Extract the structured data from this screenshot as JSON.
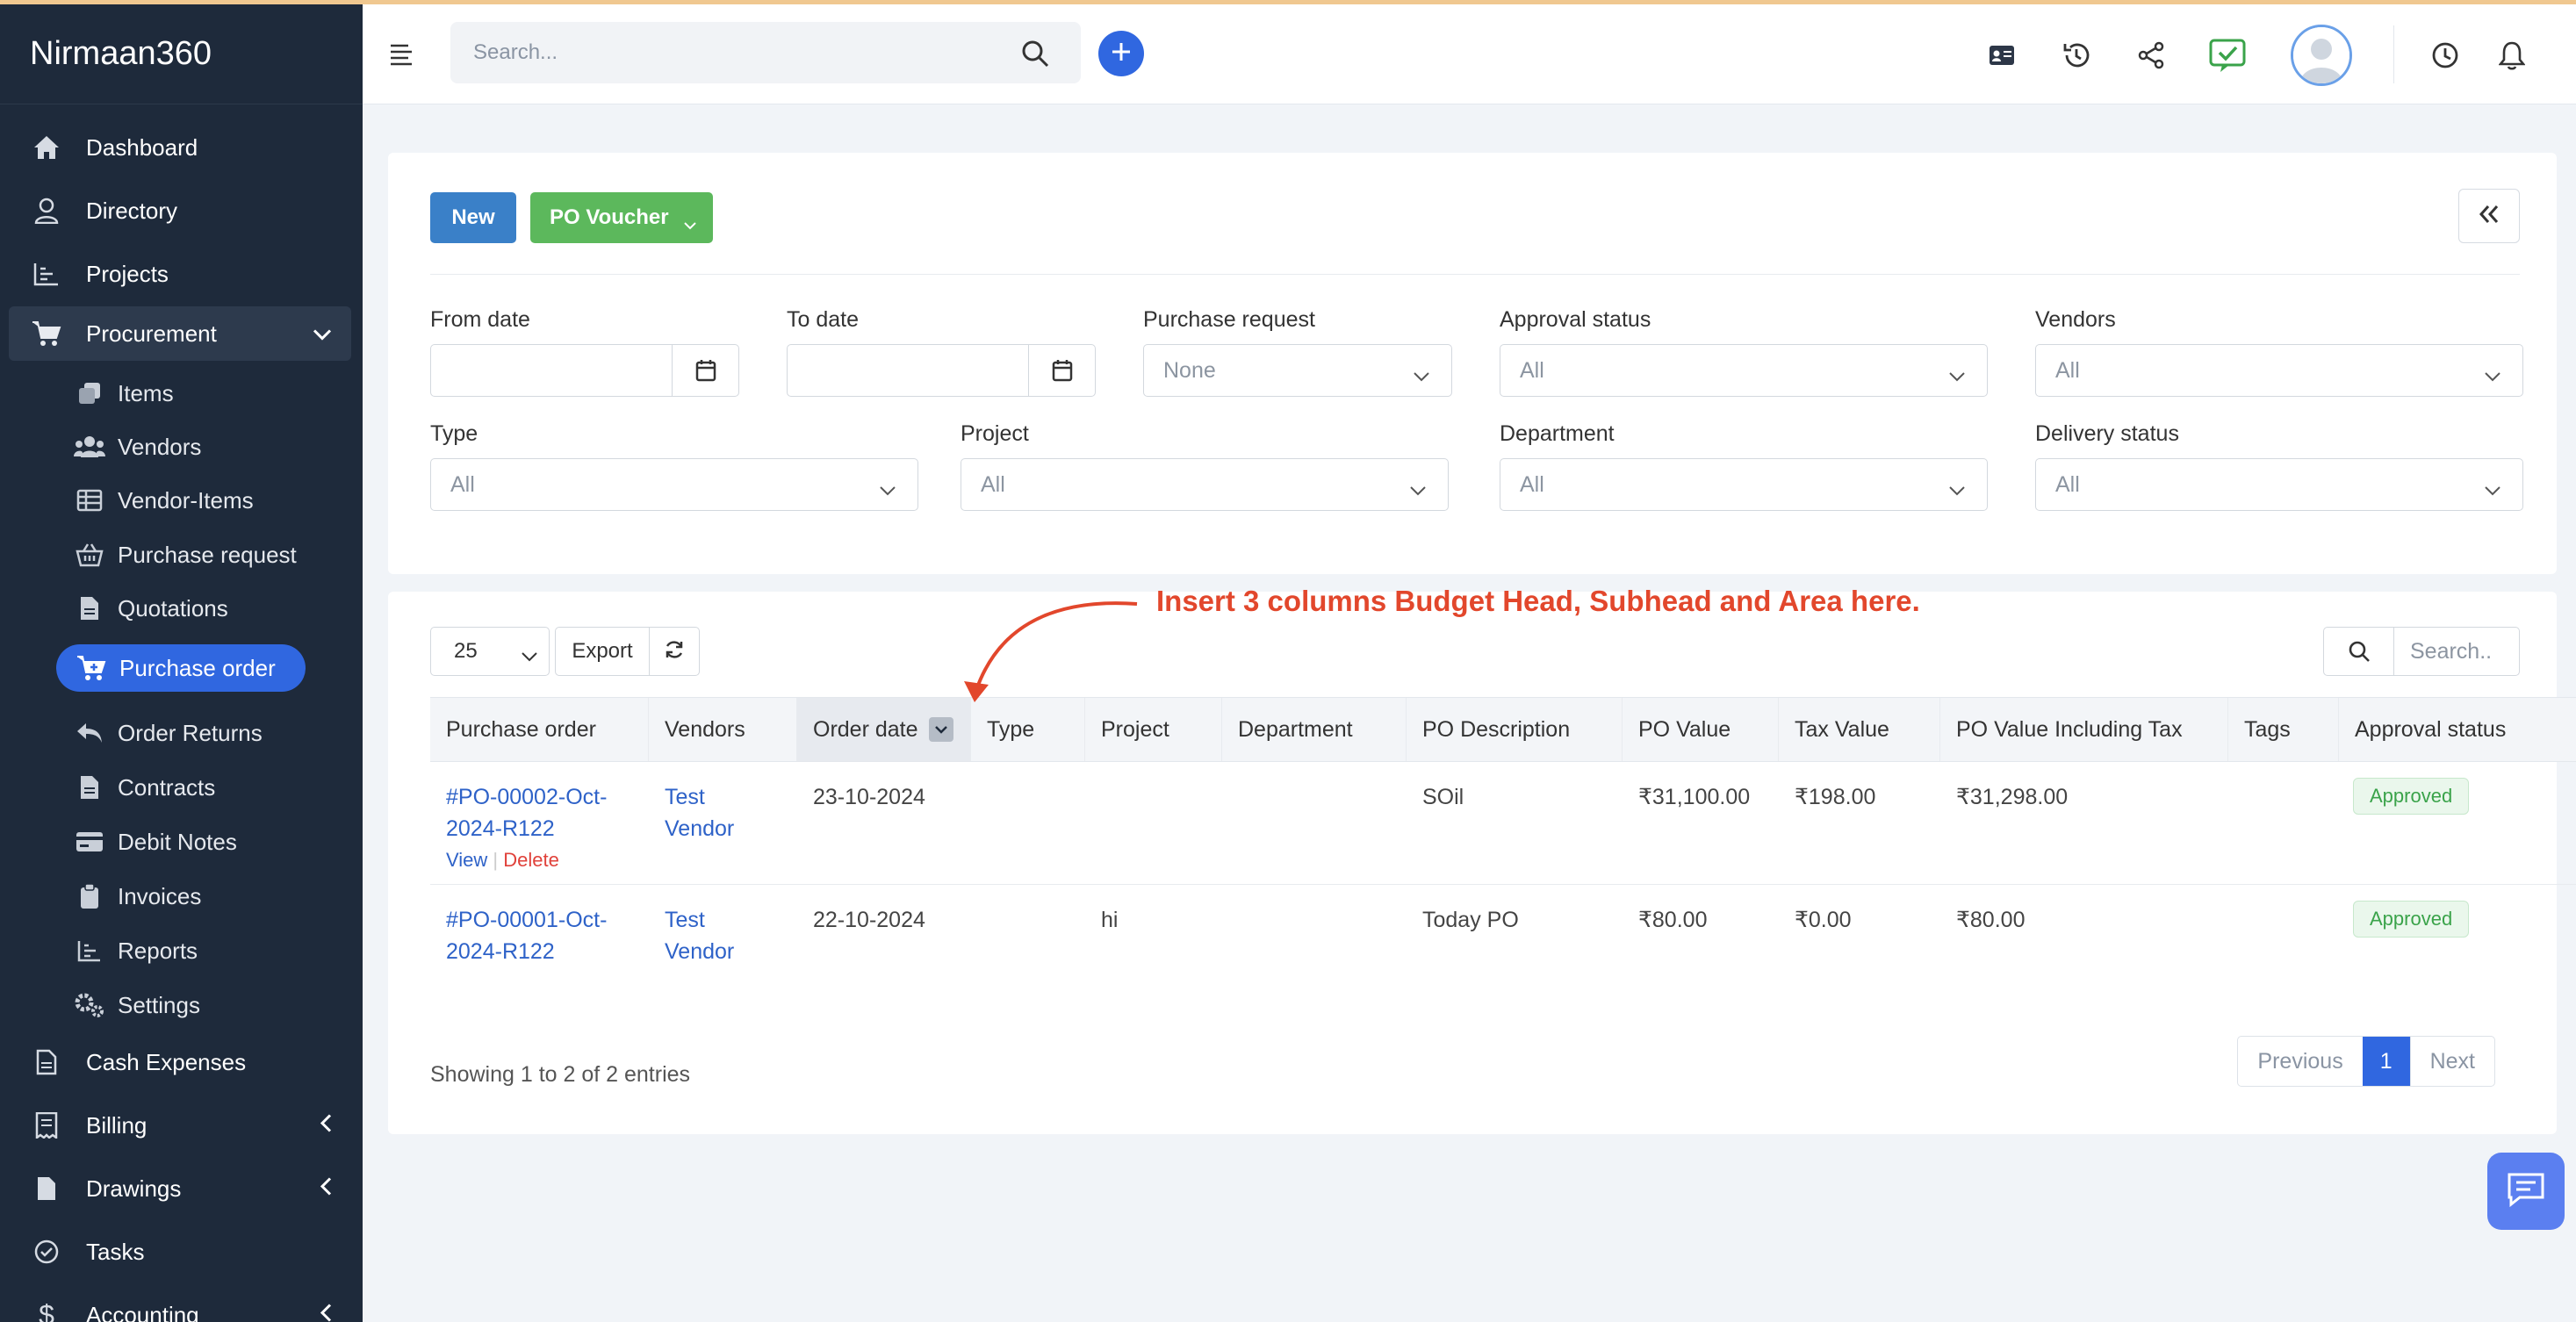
{
  "app": {
    "brand": "Nirmaan360"
  },
  "sidebar": {
    "items": [
      {
        "label": "Dashboard",
        "icon": "home-icon"
      },
      {
        "label": "Directory",
        "icon": "user-icon"
      },
      {
        "label": "Projects",
        "icon": "chart-icon"
      },
      {
        "label": "Procurement",
        "icon": "cart-icon",
        "expanded": true
      },
      {
        "label": "Cash Expenses",
        "icon": "file-icon"
      },
      {
        "label": "Billing",
        "icon": "receipt-icon"
      },
      {
        "label": "Drawings",
        "icon": "file-icon"
      },
      {
        "label": "Tasks",
        "icon": "check-circle-icon"
      },
      {
        "label": "Accounting",
        "icon": "dollar-icon"
      }
    ],
    "procurement_sub": [
      {
        "label": "Items",
        "icon": "copy-icon"
      },
      {
        "label": "Vendors",
        "icon": "users-icon"
      },
      {
        "label": "Vendor-Items",
        "icon": "table-icon"
      },
      {
        "label": "Purchase request",
        "icon": "basket-icon"
      },
      {
        "label": "Quotations",
        "icon": "file-icon"
      },
      {
        "label": "Purchase order",
        "icon": "cart-icon",
        "active": true
      },
      {
        "label": "Order Returns",
        "icon": "return-icon"
      },
      {
        "label": "Contracts",
        "icon": "file-icon"
      },
      {
        "label": "Debit Notes",
        "icon": "card-icon"
      },
      {
        "label": "Invoices",
        "icon": "clipboard-icon"
      },
      {
        "label": "Reports",
        "icon": "chart-icon"
      },
      {
        "label": "Settings",
        "icon": "gears-icon"
      }
    ]
  },
  "topbar": {
    "search_placeholder": "Search..."
  },
  "toolbar": {
    "new_label": "New",
    "voucher_label": "PO Voucher"
  },
  "filters": {
    "from_date": {
      "label": "From date",
      "value": ""
    },
    "to_date": {
      "label": "To date",
      "value": ""
    },
    "purchase_request": {
      "label": "Purchase request",
      "value": "None"
    },
    "approval_status": {
      "label": "Approval status",
      "value": "All"
    },
    "vendors": {
      "label": "Vendors",
      "value": "All"
    },
    "type": {
      "label": "Type",
      "value": "All"
    },
    "project": {
      "label": "Project",
      "value": "All"
    },
    "department": {
      "label": "Department",
      "value": "All"
    },
    "delivery_status": {
      "label": "Delivery status",
      "value": "All"
    }
  },
  "table": {
    "page_length": "25",
    "export_label": "Export",
    "search_placeholder": "Search..",
    "columns": [
      "Purchase order",
      "Vendors",
      "Order date",
      "Type",
      "Project",
      "Department",
      "PO Description",
      "PO Value",
      "Tax Value",
      "PO Value Including Tax",
      "Tags",
      "Approval status"
    ],
    "rows": [
      {
        "po_line1": "#PO-00002-Oct-",
        "po_line2": "2024-R122",
        "view": "View",
        "delete": "Delete",
        "vendor_line1": "Test",
        "vendor_line2": "Vendor",
        "order_date": "23-10-2024",
        "type": "",
        "project": "",
        "department": "",
        "description": "SOil",
        "po_value": "₹31,100.00",
        "tax_value": "₹198.00",
        "po_value_incl_tax": "₹31,298.00",
        "tags": "",
        "approval_status": "Approved"
      },
      {
        "po_line1": "#PO-00001-Oct-",
        "po_line2": "2024-R122",
        "view": "",
        "delete": "",
        "vendor_line1": "Test",
        "vendor_line2": "Vendor",
        "order_date": "22-10-2024",
        "type": "",
        "project": "hi",
        "department": "",
        "description": "Today PO",
        "po_value": "₹80.00",
        "tax_value": "₹0.00",
        "po_value_incl_tax": "₹80.00",
        "tags": "",
        "approval_status": "Approved"
      }
    ],
    "info": "Showing 1 to 2 of 2 entries",
    "pagination": {
      "previous": "Previous",
      "current": "1",
      "next": "Next"
    }
  },
  "annotation": {
    "text": "Insert 3 columns Budget Head, Subhead and Area here.",
    "color": "#e2472c"
  },
  "colors": {
    "accent": "#3067e0",
    "sidebar_bg": "#1e2a3b",
    "success": "#5cb85c",
    "primary_button": "#3a80c8"
  }
}
